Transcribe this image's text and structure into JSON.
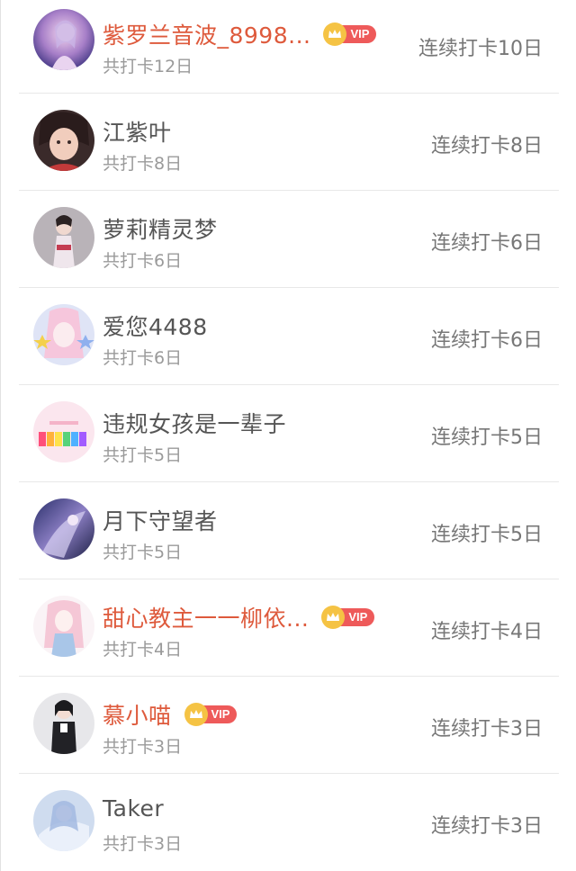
{
  "vip_badge_label": "VIP",
  "colors": {
    "vip_name": "#de5a3c",
    "normal_name": "#555555",
    "vip_badge": "#ee5a5a",
    "crown": "#f5c344"
  },
  "members": [
    {
      "name": "紫罗兰音波_8998...",
      "vip": true,
      "total": "共打卡12日",
      "streak": "连续打卡10日",
      "avatar": "avatar-image"
    },
    {
      "name": "江紫叶",
      "vip": false,
      "total": "共打卡8日",
      "streak": "连续打卡8日",
      "avatar": "avatar-image"
    },
    {
      "name": "萝莉精灵梦",
      "vip": false,
      "total": "共打卡6日",
      "streak": "连续打卡6日",
      "avatar": "avatar-image"
    },
    {
      "name": "爱您4488",
      "vip": false,
      "total": "共打卡6日",
      "streak": "连续打卡6日",
      "avatar": "avatar-image"
    },
    {
      "name": "违规女孩是一辈子",
      "vip": false,
      "total": "共打卡5日",
      "streak": "连续打卡5日",
      "avatar": "avatar-image"
    },
    {
      "name": "月下守望者",
      "vip": false,
      "total": "共打卡5日",
      "streak": "连续打卡5日",
      "avatar": "avatar-image"
    },
    {
      "name": "甜心教主一一柳依...",
      "vip": true,
      "total": "共打卡4日",
      "streak": "连续打卡4日",
      "avatar": "avatar-image"
    },
    {
      "name": "慕小喵",
      "vip": true,
      "total": "共打卡3日",
      "streak": "连续打卡3日",
      "avatar": "avatar-image"
    },
    {
      "name": "Taker",
      "vip": false,
      "total": "共打卡3日",
      "streak": "连续打卡3日",
      "avatar": "avatar-image"
    }
  ]
}
